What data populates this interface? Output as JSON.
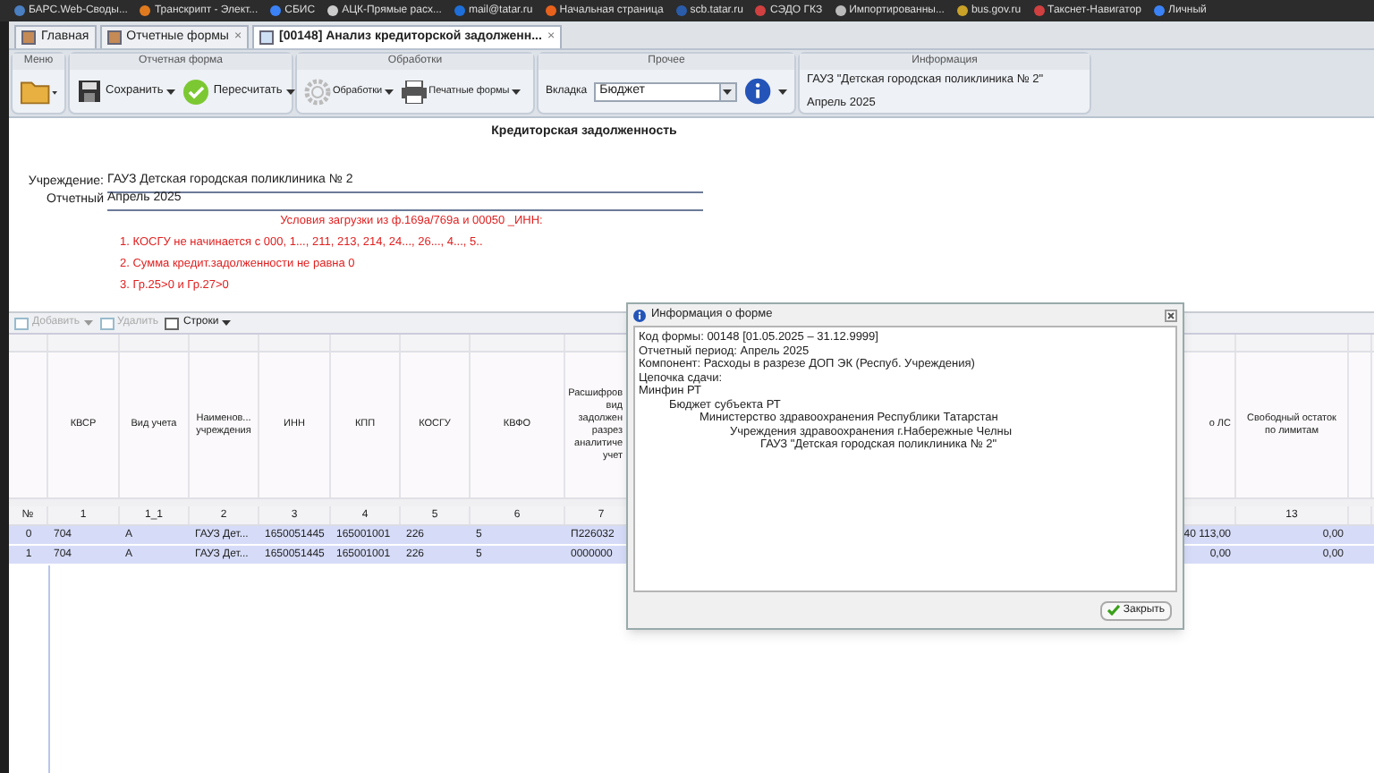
{
  "bookmarks": [
    {
      "label": "БАРС.Web-Своды...",
      "color": "#4a7fc1"
    },
    {
      "label": "Транскрипт - Элект...",
      "color": "#e07a1f"
    },
    {
      "label": "СБИС",
      "color": "#3b82f6"
    },
    {
      "label": "АЦК-Прямые расх...",
      "color": "#cccccc"
    },
    {
      "label": "mail@tatar.ru",
      "color": "#1e6fd9"
    },
    {
      "label": "Начальная страница",
      "color": "#e8621c"
    },
    {
      "label": "scb.tatar.ru",
      "color": "#2a5caa"
    },
    {
      "label": "СЭДО ГКЗ",
      "color": "#d04040"
    },
    {
      "label": "Импортированны...",
      "color": "#bbbbbb"
    },
    {
      "label": "bus.gov.ru",
      "color": "#c9a227"
    },
    {
      "label": "Такснет-Навигатор",
      "color": "#d04040"
    },
    {
      "label": "Личный",
      "color": "#3b82f6"
    }
  ],
  "tabs": [
    {
      "label": "Главная",
      "selected": false
    },
    {
      "label": "Отчетные формы",
      "selected": false,
      "close": "×"
    },
    {
      "label": "[00148] Анализ кредиторской задолженн...",
      "selected": true,
      "close": "×"
    }
  ],
  "ribbon": {
    "menu": {
      "title": "Меню"
    },
    "report": {
      "title": "Отчетная форма",
      "save": "Сохранить",
      "recalc": "Пересчитать"
    },
    "processing": {
      "title": "Обработки",
      "processing": "Обработки",
      "print": "Печатные формы"
    },
    "other": {
      "title": "Прочее",
      "tab_label": "Вкладка",
      "tab_value": "Бюджет"
    },
    "info": {
      "title": "Информация",
      "org": "ГАУЗ \"Детская городская поликлиника № 2\"",
      "period": "Апрель 2025"
    }
  },
  "report": {
    "title": "Кредиторская задолженность",
    "fields": [
      {
        "label": "Учреждение:",
        "value": "ГАУЗ Детская городская поликлиника № 2"
      },
      {
        "label": "Отчетный",
        "value": "Апрель 2025"
      }
    ],
    "conditions_title": "Условия загрузки из ф.169а/769а и 00050 _ИНН:",
    "conditions": [
      "1. КОСГУ не начинается с 000, 1..., 211, 213, 214, 24..., 26..., 4..., 5..",
      "2. Сумма кредит.задолженности не равна 0",
      "3. Гр.25>0 и Гр.27>0"
    ]
  },
  "grid": {
    "toolbar": [
      {
        "label": "Добавить",
        "disabled": true,
        "menu": true
      },
      {
        "label": "Удалить",
        "disabled": true,
        "menu": false
      },
      {
        "label": "Строки",
        "disabled": false,
        "menu": true
      }
    ],
    "columns": [
      {
        "kind": "num",
        "number": "№"
      },
      {
        "kind": "text",
        "header": [
          "КВСР"
        ],
        "number": "1"
      },
      {
        "kind": "text",
        "header": [
          "Вид учета"
        ],
        "number": "1_1"
      },
      {
        "kind": "text",
        "header": [
          "Наименов...",
          "учреждения"
        ],
        "number": "2"
      },
      {
        "kind": "text",
        "header": [
          "ИНН"
        ],
        "number": "3"
      },
      {
        "kind": "text",
        "header": [
          "КПП"
        ],
        "number": "4"
      },
      {
        "kind": "text",
        "header": [
          "КОСГУ"
        ],
        "number": "5"
      },
      {
        "kind": "text",
        "header": [
          "КВФО"
        ],
        "number": "6"
      },
      {
        "kind": "text",
        "header": [
          "Расшифров",
          "вид",
          "задолжен",
          "разрез",
          "аналитиче",
          "учет"
        ],
        "number": "7"
      },
      {
        "kind": "money",
        "header": [
          "о ЛС"
        ]
      },
      {
        "kind": "money",
        "header": [
          "Свободный остаток",
          "по лимитам"
        ],
        "number": "13"
      }
    ],
    "rows": [
      {
        "selected": true,
        "cells": [
          "0",
          "704",
          "А",
          "ГАУЗ Дет...",
          "1650051445",
          "165001001",
          "226",
          "5",
          "П226032",
          "40 113,00",
          "0,00"
        ]
      },
      {
        "selected": true,
        "cells": [
          "1",
          "704",
          "А",
          "ГАУЗ Дет...",
          "1650051445",
          "165001001",
          "226",
          "5",
          "0000000",
          "0,00",
          "0,00"
        ]
      }
    ]
  },
  "dialog": {
    "title": "Информация о форме",
    "lines": [
      {
        "text": "Код формы: 00148 [01.05.2025 – 31.12.9999]"
      },
      {
        "text": "Отчетный период: Апрель 2025"
      },
      {
        "text": "Компонент: Расходы в разрезе ДОП ЭК (Респуб. Учреждения)"
      },
      {
        "text": "Цепочка сдачи:"
      },
      {
        "text": "Минфин РТ",
        "children": [
          {
            "text": "Бюджет субъекта РТ",
            "children": [
              {
                "text": "Министерство здравоохранения Республики Татарстан",
                "children": [
                  {
                    "text": "Учреждения здравоохранения г.Набережные Челны",
                    "children": [
                      {
                        "text": "ГАУЗ \"Детская городская поликлиника № 2\""
                      }
                    ]
                  }
                ]
              }
            ]
          }
        ]
      }
    ],
    "close": "Закрыть"
  }
}
